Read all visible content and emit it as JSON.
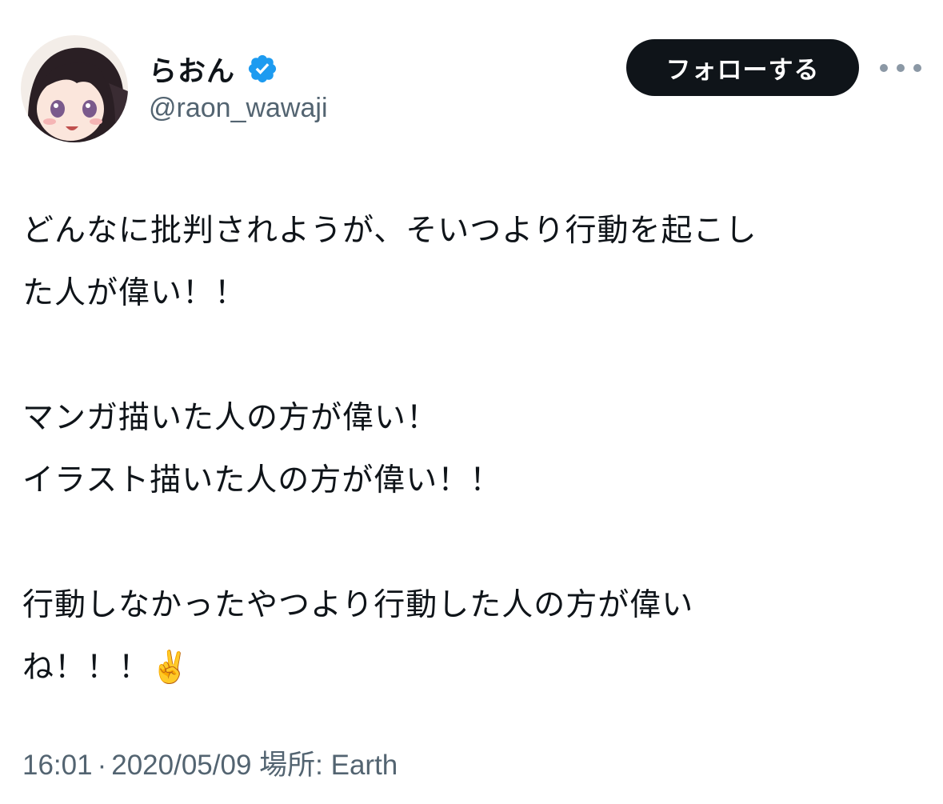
{
  "user": {
    "display_name": "らおん",
    "handle": "@raon_wawaji",
    "verified_icon": "verified-badge-icon",
    "avatar_icon": "avatar-anime-girl"
  },
  "actions": {
    "follow_label": "フォローする",
    "more_icon": "more-horizontal-icon"
  },
  "tweet": {
    "lines": [
      "どんなに批判されようが、そいつより行動を起こし",
      "た人が偉い！！",
      "",
      "マンガ描いた人の方が偉い！",
      "イラスト描いた人の方が偉い！！",
      "",
      "行動しなかったやつより行動した人の方が偉い",
      "ね！！！✌️"
    ]
  },
  "meta": {
    "time": "16:01",
    "separator": "·",
    "date": "2020/05/09",
    "location_label": "場所: Earth"
  },
  "colors": {
    "follow_bg": "#0f1419",
    "secondary_text": "#536471",
    "verified_blue": "#1d9bf0"
  }
}
